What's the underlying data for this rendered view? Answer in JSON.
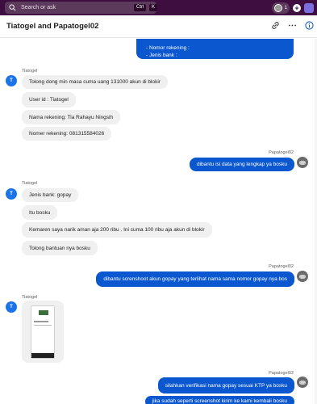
{
  "topbar": {
    "search_placeholder": "Search or ask",
    "shortcut_ctrl": "Ctrl",
    "shortcut_k": "K",
    "collab_count": "1"
  },
  "header": {
    "title": "Tiatogel and Papatogel02"
  },
  "top_message": {
    "lines": [
      "- Nomor rekening :",
      "- Jenis bank :"
    ]
  },
  "messages": [
    {
      "sender": "Tiatogel",
      "text": "Tolong dong min masa cuma uang 131000 akun di blokir"
    },
    {
      "text": "User id : Tiatogel"
    },
    {
      "text": "Nama rekening: Tia Rahayu Ningsih"
    },
    {
      "text": "Nomer rekening: 081315584026"
    },
    {
      "sender": "Papatogel02",
      "text": "dibantu isi data yang lengkap ya bosku"
    },
    {
      "sender": "Tiatogel",
      "text": "Jenis bank: gopay"
    },
    {
      "text": "Itu bosku"
    },
    {
      "text": "Kemaren saya narik aman aja 200 ribu . Ini cuma 100 ribu aja akun di blokir"
    },
    {
      "text": "Tolong bantuan nya bosku"
    },
    {
      "sender": "Papatogel02",
      "text": "dibantu screnshoot akun gopay yang terlihat nama sama nomor gopay nya bos"
    },
    {
      "sender": "Tiatogel"
    },
    {
      "sender": "Papatogel02",
      "text": "silahkan verifikasi nama gopay sesuai KTP ya bosku"
    },
    {
      "text": "jika sudah seperti screenshot kirim ke kami kembali bosku"
    }
  ],
  "avatar_initial": "T",
  "colors": {
    "outgoing": "#0b57d0",
    "incoming": "#f0f0f0",
    "topbar": "#3f0e40"
  },
  "icons": [
    "search-icon",
    "plus-icon",
    "link-icon",
    "more-icon",
    "info-icon"
  ]
}
